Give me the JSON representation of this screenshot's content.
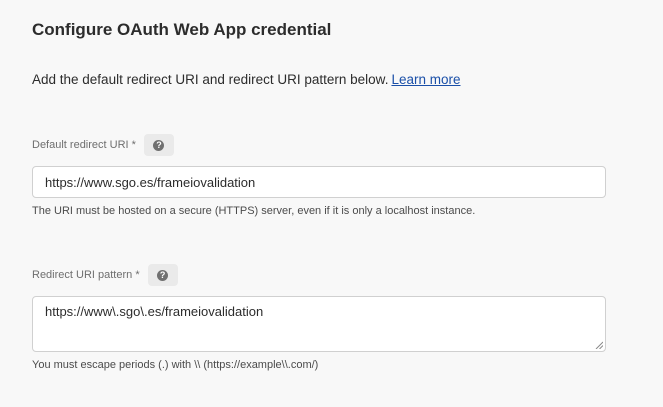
{
  "page": {
    "title": "Configure OAuth Web App credential",
    "intro_text": "Add the default redirect URI and redirect URI pattern below.",
    "learn_more": "Learn more"
  },
  "default_redirect": {
    "label": "Default redirect URI *",
    "value": "https://www.sgo.es/frameiovalidation",
    "hint": "The URI must be hosted on a secure (HTTPS) server, even if it is only a localhost instance.",
    "help_icon": "question-circle-icon"
  },
  "redirect_pattern": {
    "label": "Redirect URI pattern *",
    "value": "https://www\\.sgo\\.es/frameiovalidation",
    "hint": "You must escape periods (.) with \\\\ (https://example\\\\.com/)",
    "help_icon": "question-circle-icon"
  }
}
